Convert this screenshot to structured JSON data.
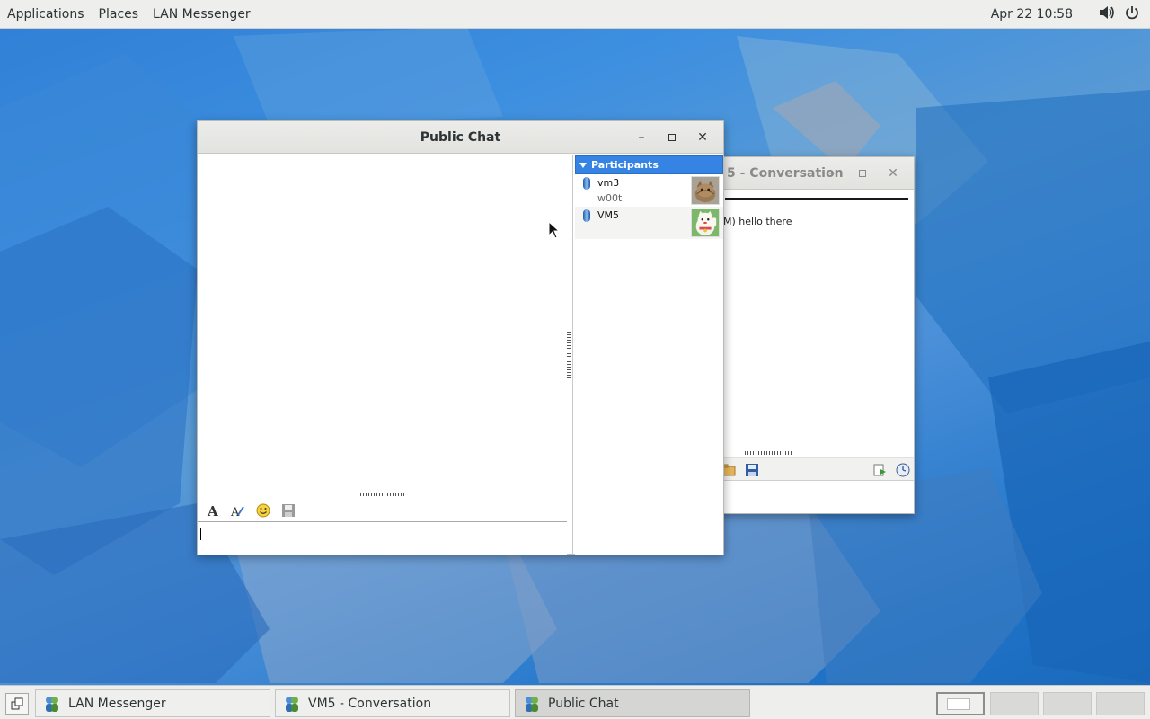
{
  "topbar": {
    "applications": "Applications",
    "places": "Places",
    "app_menu": "LAN Messenger",
    "clock": "Apr 22  10:58",
    "volume_icon": "volume-icon",
    "power_icon": "power-icon"
  },
  "conversation_window": {
    "title": "5 - Conversation",
    "message": "M) hello there"
  },
  "public_chat": {
    "title": "Public Chat",
    "input_value": "",
    "participants_header": "Participants",
    "participants": [
      {
        "name": "vm3",
        "note": "w00t",
        "avatar": "cat-avatar"
      },
      {
        "name": "VM5",
        "note": "",
        "avatar": "lucky-cat-avatar"
      }
    ]
  },
  "taskbar": {
    "tasks": [
      {
        "label": "LAN Messenger"
      },
      {
        "label": "VM5 - Conversation"
      },
      {
        "label": "Public Chat"
      }
    ],
    "workspaces": 4
  },
  "colors": {
    "accent": "#3584e4",
    "panel": "#eeeeec"
  }
}
